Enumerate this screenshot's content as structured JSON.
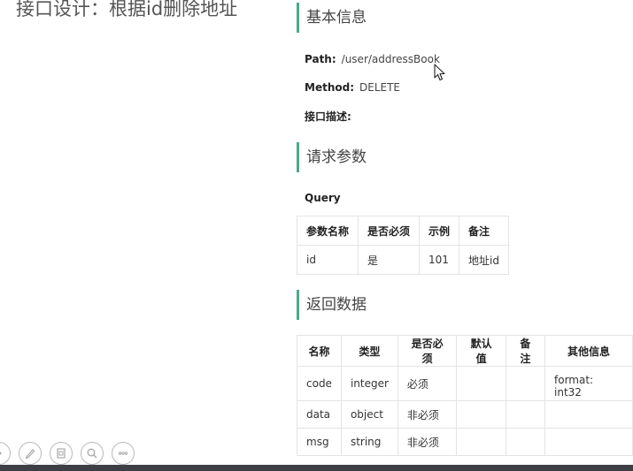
{
  "slide": {
    "title": "接口设计：根据id删除地址"
  },
  "doc": {
    "basic_info": {
      "heading": "基本信息",
      "path_label": "Path:",
      "path_value": "/user/addressBook",
      "method_label": "Method:",
      "method_value": "DELETE",
      "desc_label": "接口描述:"
    },
    "request_params": {
      "heading": "请求参数",
      "query_label": "Query",
      "columns": [
        "参数名称",
        "是否必须",
        "示例",
        "备注"
      ],
      "rows": [
        [
          "id",
          "是",
          "101",
          "地址id"
        ]
      ]
    },
    "response_data": {
      "heading": "返回数据",
      "columns": [
        "名称",
        "类型",
        "是否必须",
        "默认值",
        "备注",
        "其他信息"
      ],
      "rows": [
        [
          "code",
          "integer",
          "必须",
          "",
          "",
          "format: int32"
        ],
        [
          "data",
          "object",
          "非必须",
          "",
          "",
          ""
        ],
        [
          "msg",
          "string",
          "非必须",
          "",
          "",
          ""
        ]
      ]
    }
  },
  "toolbar": {
    "icons": [
      "next-arrow-icon",
      "pen-icon",
      "slides-icon",
      "zoom-icon",
      "more-icon"
    ]
  }
}
